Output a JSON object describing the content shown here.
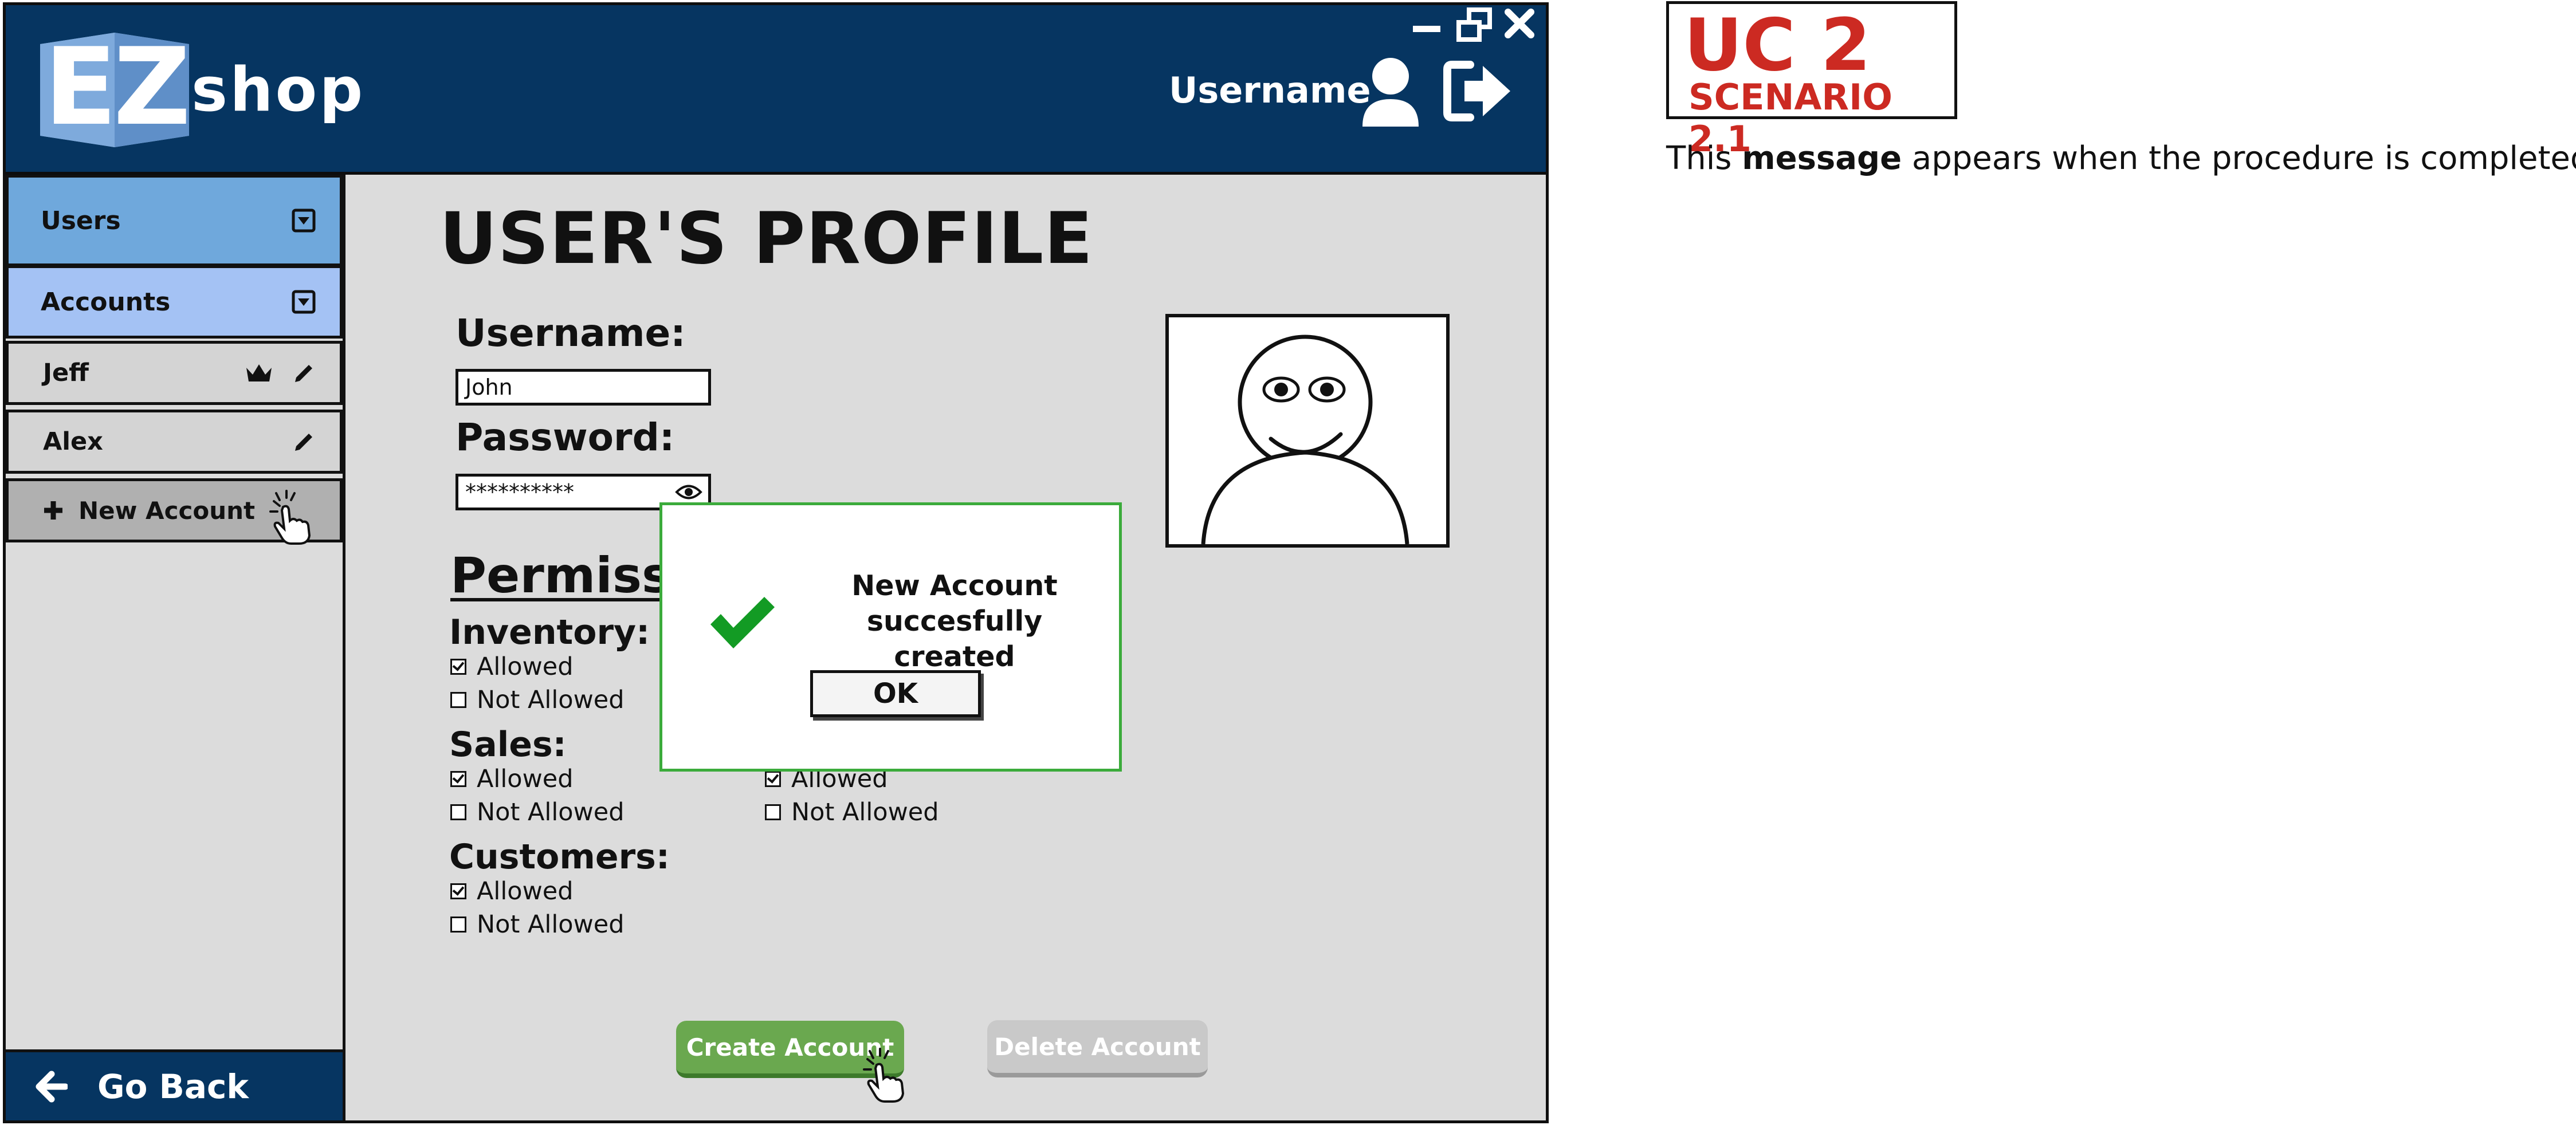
{
  "brand": {
    "logo_letters": "EZ",
    "shop": "shop"
  },
  "header": {
    "username": "Username"
  },
  "sidebar": {
    "users": "Users",
    "accounts": "Accounts",
    "items": [
      {
        "label": "Jeff"
      },
      {
        "label": "Alex"
      }
    ],
    "new_account": "New Account",
    "go_back": "Go Back"
  },
  "profile": {
    "title": "USER'S PROFILE",
    "username_label": "Username:",
    "username_value": "John",
    "password_label": "Password:",
    "password_value": "**********",
    "permissions_heading": "Permissions",
    "sections": [
      {
        "title": "Inventory:",
        "allowed": "Allowed",
        "not_allowed": "Not Allowed"
      },
      {
        "title": "Sales:",
        "allowed": "Allowed",
        "not_allowed": "Not Allowed"
      },
      {
        "title": "Customers:",
        "allowed": "Allowed",
        "not_allowed": "Not Allowed"
      }
    ],
    "right_column": {
      "allowed": "Allowed",
      "not_allowed": "Not Allowed"
    },
    "create_button": "Create Account",
    "delete_button": "Delete Account"
  },
  "dialog": {
    "line1": "New Account",
    "line2": "succesfully created",
    "ok": "OK"
  },
  "annotation": {
    "uc": "UC 2",
    "scenario": "SCENARIO 2.1",
    "note_pre": "This ",
    "note_bold": "message",
    "note_post": " appears when the procedure is completed."
  },
  "colors": {
    "header_bg": "#063561",
    "users_bg": "#6fa8dc",
    "accounts_bg": "#a4c2f4",
    "create_green": "#6aa84f",
    "dialog_border": "#3bab3b",
    "uc_red": "#cc2a22"
  }
}
